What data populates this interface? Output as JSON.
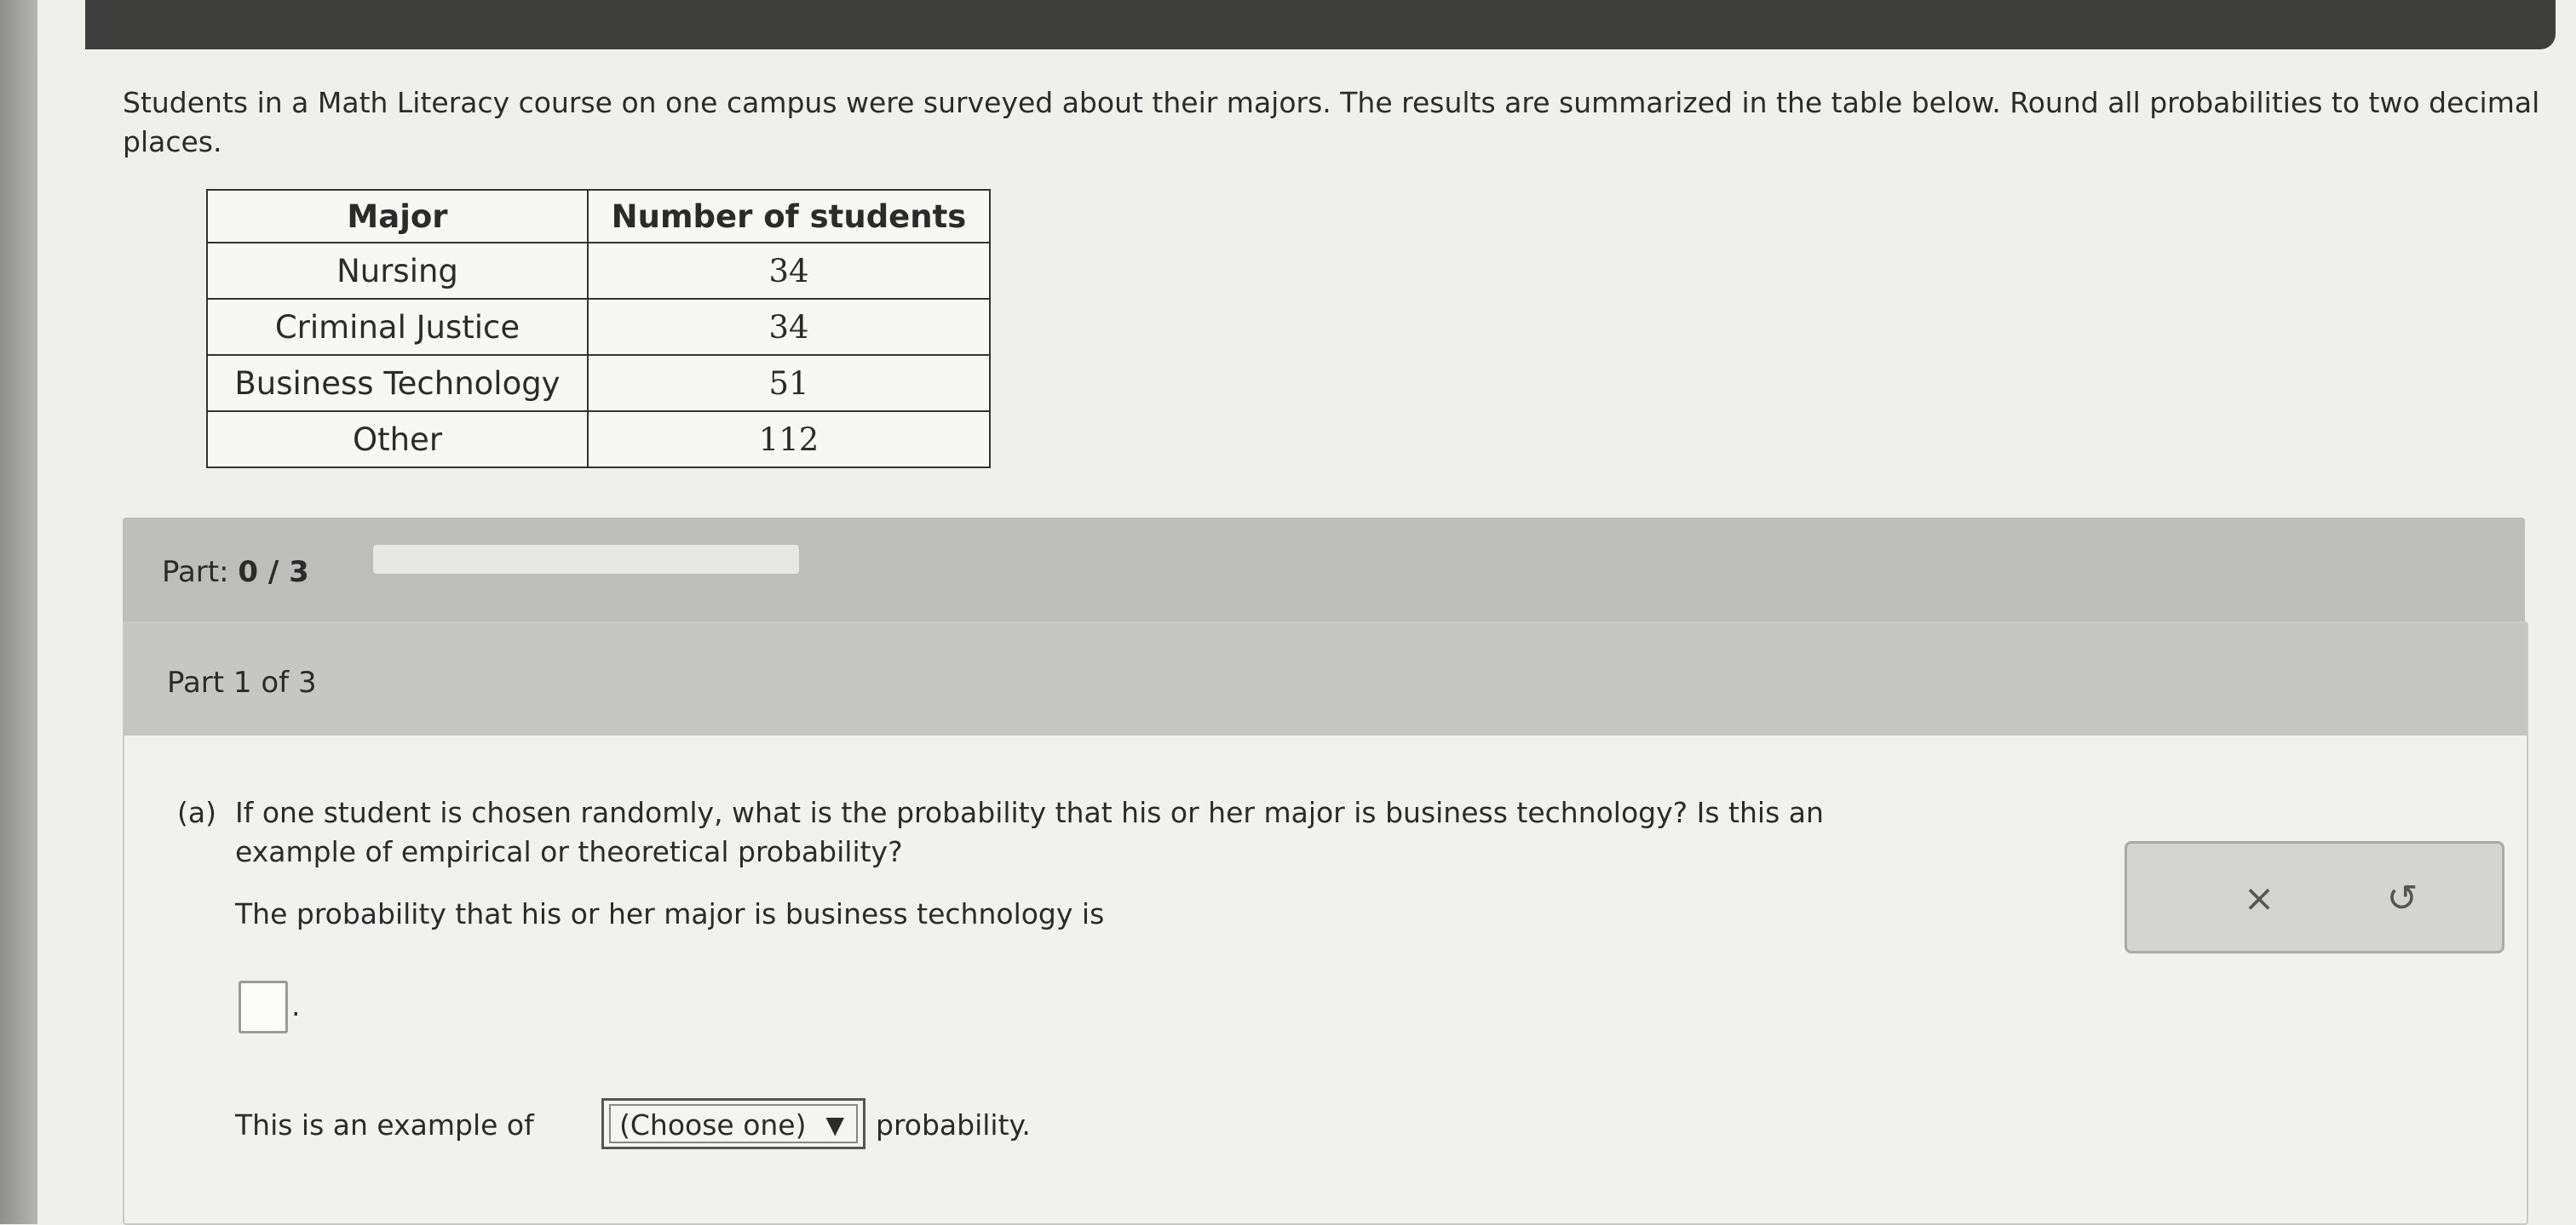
{
  "intro": {
    "text": "Students in a Math Literacy course on one campus were surveyed about their majors. The results are summarized in the table below. Round all probabilities to two decimal places."
  },
  "table": {
    "headers": [
      "Major",
      "Number of students"
    ],
    "rows": [
      {
        "major": "Nursing",
        "count": "34"
      },
      {
        "major": "Criminal Justice",
        "count": "34"
      },
      {
        "major": "Business Technology",
        "count": "51"
      },
      {
        "major": "Other",
        "count": "112"
      }
    ]
  },
  "progress": {
    "label": "Part:",
    "value_text": "0 / 3",
    "fraction": 0
  },
  "part": {
    "header": "Part 1 of 3",
    "question_label": "(a)",
    "question_line1": "If one student is chosen randomly, what is the probability that his or her major is business technology? Is this an",
    "question_line2": "example of empirical or theoretical probability?",
    "probability_text": "The probability that his or her major is business technology is",
    "answer_value": "",
    "period": ".",
    "example_prefix": "This is an example of",
    "select_value": "(Choose one)",
    "example_suffix": "probability."
  },
  "actions": {
    "clear_icon": "×",
    "undo_icon": "↺"
  },
  "colors": {
    "accent": "#4a8bcf",
    "top_bar": "#3e3e3c"
  }
}
